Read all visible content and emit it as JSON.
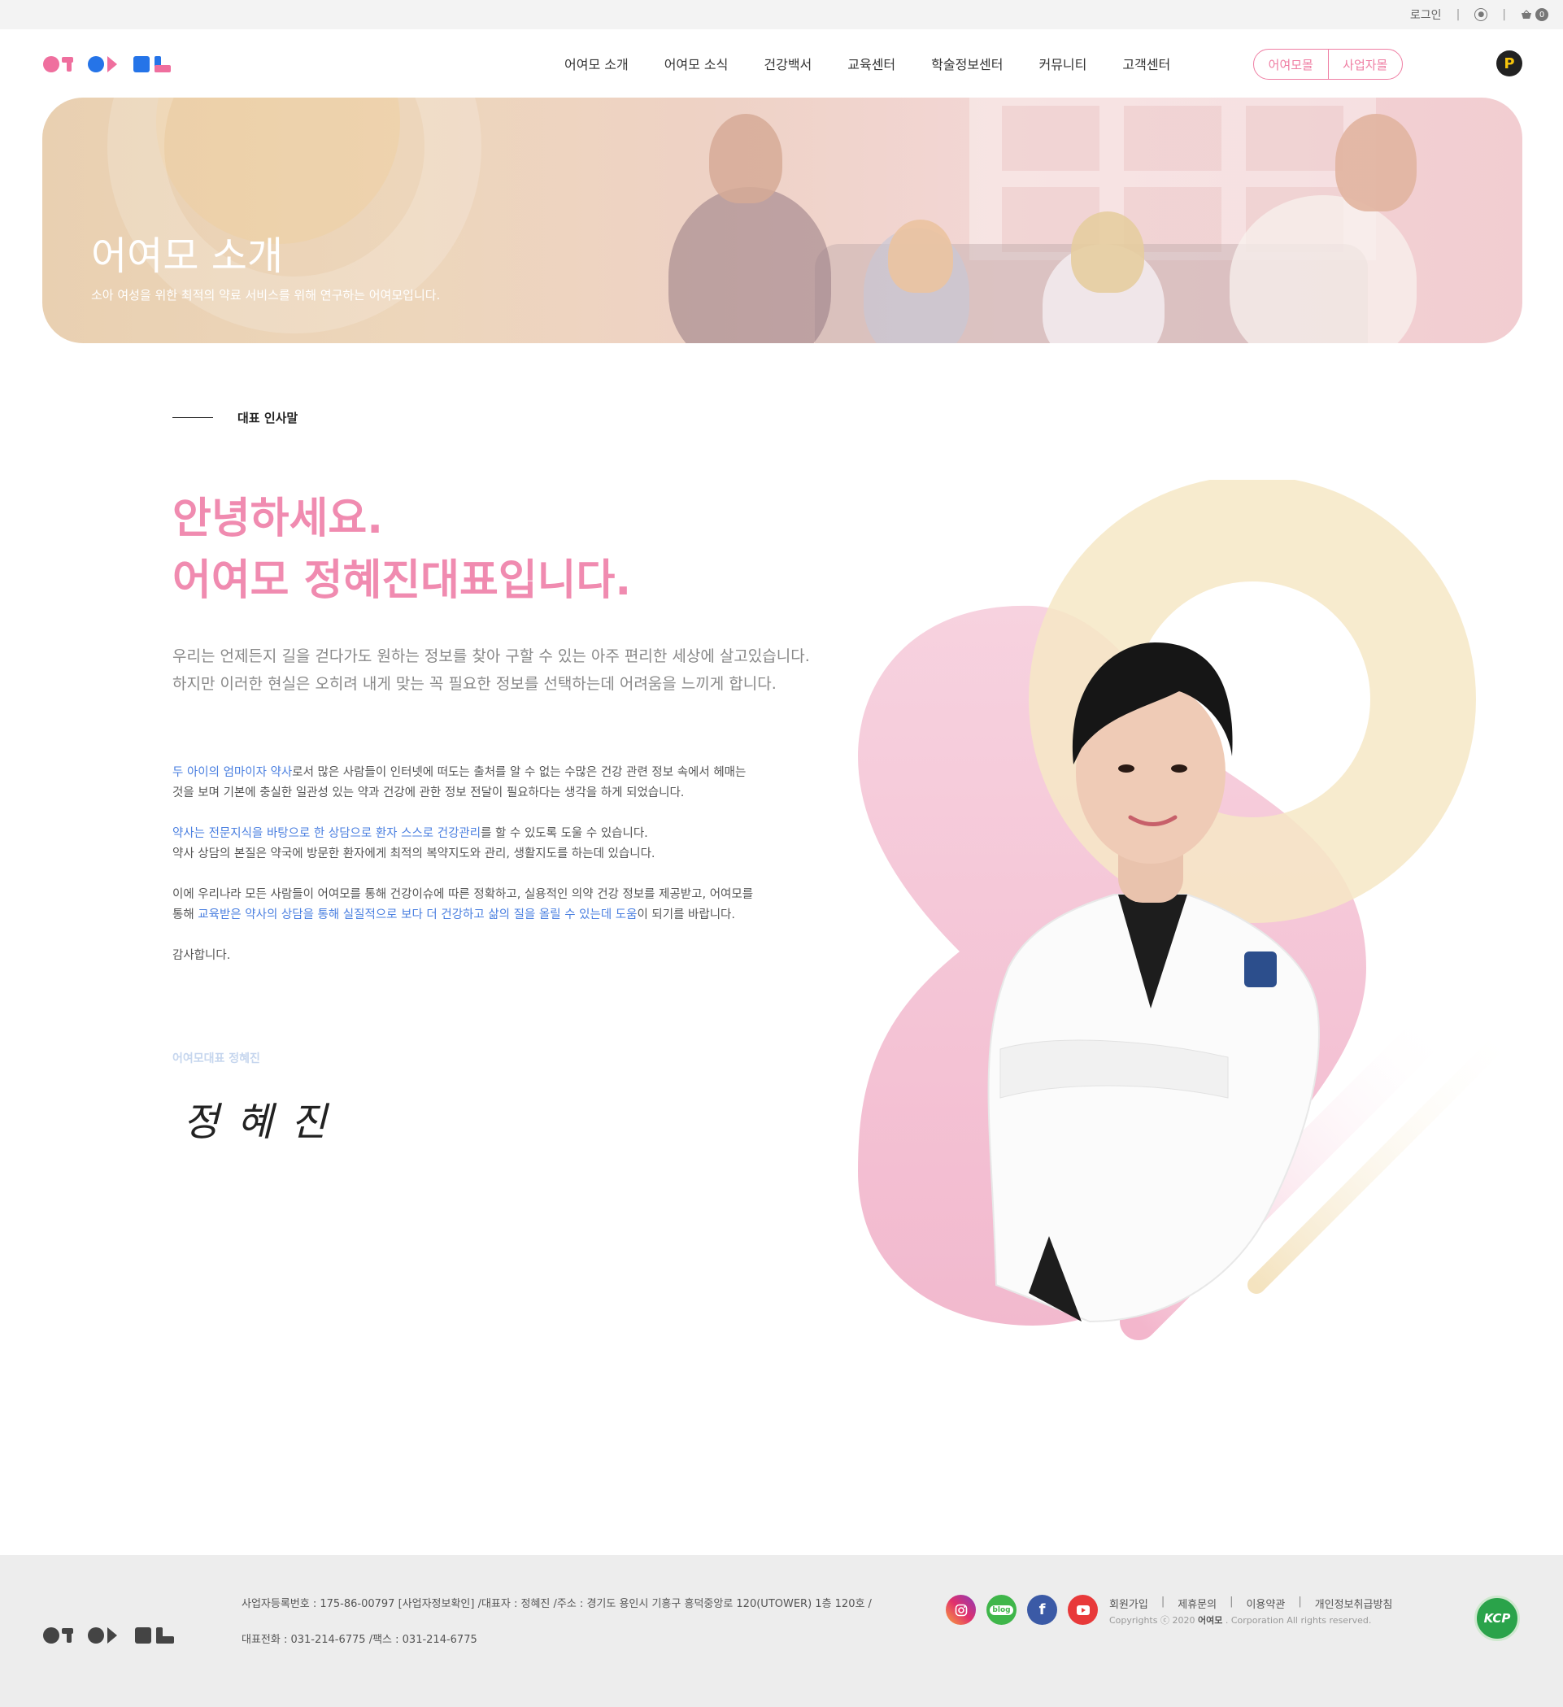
{
  "topbar": {
    "login": "로그인",
    "cart_count": "0"
  },
  "nav": {
    "items": [
      "어여모 소개",
      "어여모 소식",
      "건강백서",
      "교육센터",
      "학술정보센터",
      "커뮤니티",
      "고객센터"
    ],
    "shop_mall": "어여모몰",
    "business_mall": "사업자몰",
    "point_badge": "P"
  },
  "hero": {
    "title": "어여모 소개",
    "subtitle": "소아 여성을 위한 최적의 약료 서비스를 위해 연구하는 어여모입니다."
  },
  "section": {
    "label": "대표 인사말"
  },
  "greeting": {
    "line1": "안녕하세요.",
    "line2": "어여모 정혜진대표입니다.",
    "lead1": "우리는 언제든지 길을 걷다가도 원하는 정보를 찾아 구할 수 있는 아주 편리한 세상에 살고있습니다.",
    "lead2": "하지만 이러한 현실은 오히려 내게 맞는 꼭 필요한 정보를 선택하는데 어려움을 느끼게 합니다."
  },
  "body": {
    "p1_hl": "두 아이의 엄마이자 약사",
    "p1_a": "로서 많은 사람들이 인터넷에 떠도는 출처를 알 수 없는 수많은 건강 관련 정보 속에서 헤매는",
    "p1_b": "것을 보며 기본에 충실한 일관성 있는 약과 건강에 관한 정보 전달이 필요하다는 생각을 하게 되었습니다.",
    "p2_hl": "약사는 전문지식을 바탕으로 한 상담으로 환자 스스로 건강관리",
    "p2_a": "를 할 수 있도록 도울 수 있습니다.",
    "p2_b": "약사 상담의 본질은 약국에 방문한 환자에게 최적의 복약지도와 관리, 생활지도를 하는데 있습니다.",
    "p3_a": "이에 우리나라 모든 사람들이 어여모를 통해 건강이슈에 따른 정확하고, 실용적인 의약 건강 정보를 제공받고, 어여모를",
    "p3_b": "통해 ",
    "p3_hl": "교육받은 약사의 상담을 통해 실질적으로 보다 더 건강하고 삶의 질을 올릴 수 있는데 도움",
    "p3_c": "이 되기를 바랍니다.",
    "p4": "감사합니다.",
    "sign_label": "어여모대표 정혜진",
    "signature": "정혜진"
  },
  "footer": {
    "info1": "사업자등록번호 : 175-86-00797 [사업자정보확인] /대표자 : 정혜진 /주소 : 경기도 용인시 기흥구 흥덕중앙로 120(UTOWER) 1층 120호 /",
    "info2": "대표전화 : 031-214-6775 /팩스 : 031-214-6775",
    "links": [
      "회원가입",
      "제휴문의",
      "이용약관",
      "개인정보취급방침"
    ],
    "sep": "|",
    "copy_a": "Copyrights ⓒ 2020 ",
    "copy_brand": "어여모",
    "copy_b": " . Corporation All rights reserved.",
    "sns": [
      "instagram",
      "blog",
      "facebook",
      "youtube"
    ],
    "blog_label": "blog",
    "kcp": "KCP"
  },
  "colors": {
    "accent_pink": "#f08bb0",
    "link_blue": "#4a7fe0",
    "pale_yellow": "#f6e9c8",
    "pale_pink": "#f6cadb"
  }
}
